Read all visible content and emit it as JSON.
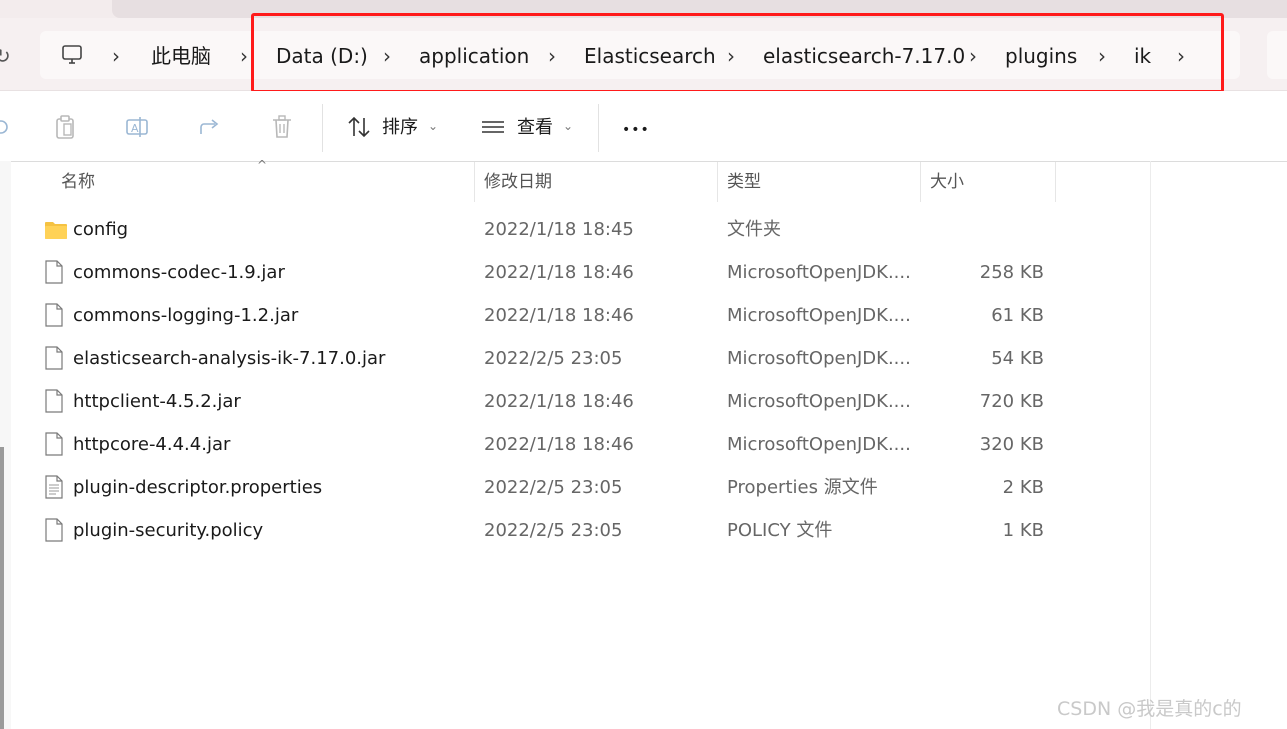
{
  "breadcrumb": {
    "items": [
      "此电脑",
      "Data (D:)",
      "application",
      "Elasticsearch",
      "elasticsearch-7.17.0",
      "plugins",
      "ik"
    ],
    "separator": "›"
  },
  "toolbar": {
    "sort_label": "排序",
    "view_label": "查看",
    "more_label": "•••"
  },
  "columns": {
    "name": "名称",
    "modified": "修改日期",
    "type": "类型",
    "size": "大小"
  },
  "files": [
    {
      "name": "config",
      "modified": "2022/1/18 18:45",
      "type": "文件夹",
      "size": "",
      "icon": "folder-icon"
    },
    {
      "name": "commons-codec-1.9.jar",
      "modified": "2022/1/18 18:46",
      "type": "MicrosoftOpenJDK....",
      "size": "258 KB",
      "icon": "file-icon"
    },
    {
      "name": "commons-logging-1.2.jar",
      "modified": "2022/1/18 18:46",
      "type": "MicrosoftOpenJDK....",
      "size": "61 KB",
      "icon": "file-icon"
    },
    {
      "name": "elasticsearch-analysis-ik-7.17.0.jar",
      "modified": "2022/2/5 23:05",
      "type": "MicrosoftOpenJDK....",
      "size": "54 KB",
      "icon": "file-icon"
    },
    {
      "name": "httpclient-4.5.2.jar",
      "modified": "2022/1/18 18:46",
      "type": "MicrosoftOpenJDK....",
      "size": "720 KB",
      "icon": "file-icon"
    },
    {
      "name": "httpcore-4.4.4.jar",
      "modified": "2022/1/18 18:46",
      "type": "MicrosoftOpenJDK....",
      "size": "320 KB",
      "icon": "file-icon"
    },
    {
      "name": "plugin-descriptor.properties",
      "modified": "2022/2/5 23:05",
      "type": "Properties 源文件",
      "size": "2 KB",
      "icon": "text-file-icon"
    },
    {
      "name": "plugin-security.policy",
      "modified": "2022/2/5 23:05",
      "type": "POLICY 文件",
      "size": "1 KB",
      "icon": "file-icon"
    }
  ],
  "watermark": "CSDN @我是真的c的",
  "colors": {
    "highlight": "#ff1a1a",
    "folder": "#f5c242"
  }
}
